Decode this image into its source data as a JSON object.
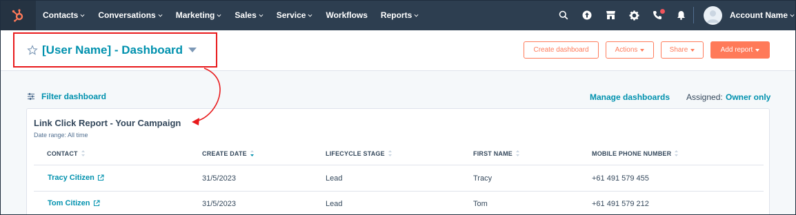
{
  "nav": {
    "items": [
      {
        "label": "Contacts",
        "has_menu": true
      },
      {
        "label": "Conversations",
        "has_menu": true
      },
      {
        "label": "Marketing",
        "has_menu": true
      },
      {
        "label": "Sales",
        "has_menu": true
      },
      {
        "label": "Service",
        "has_menu": true
      },
      {
        "label": "Workflows",
        "has_menu": false
      },
      {
        "label": "Reports",
        "has_menu": true
      }
    ],
    "icons": [
      "search-icon",
      "upgrade-icon",
      "marketplace-icon",
      "settings-icon",
      "calling-icon",
      "notifications-icon"
    ],
    "account_name": "Account Name"
  },
  "header": {
    "dashboard_title": "[User Name] - Dashboard",
    "buttons": {
      "create": "Create dashboard",
      "actions": "Actions",
      "share": "Share",
      "add_report": "Add report"
    }
  },
  "toolbar": {
    "filter_label": "Filter dashboard",
    "manage_label": "Manage dashboards",
    "assigned_label": "Assigned:",
    "assigned_value": "Owner only"
  },
  "report": {
    "title": "Link Click Report - Your Campaign",
    "date_range": "Date range: All time",
    "columns": [
      "CONTACT",
      "CREATE DATE",
      "LIFECYCLE STAGE",
      "FIRST NAME",
      "MOBILE PHONE NUMBER"
    ],
    "rows": [
      {
        "contact": "Tracy Citizen",
        "create_date": "31/5/2023",
        "lifecycle": "Lead",
        "first_name": "Tracy",
        "phone": "+61 491 579 455"
      },
      {
        "contact": "Tom Citizen",
        "create_date": "31/5/2023",
        "lifecycle": "Lead",
        "first_name": "Tom",
        "phone": "+61 491 579 212"
      }
    ]
  },
  "colors": {
    "nav_bg": "#2d3e50",
    "accent_orange": "#ff7a59",
    "link_teal": "#0091ae",
    "annotation_red": "#e8191b"
  }
}
